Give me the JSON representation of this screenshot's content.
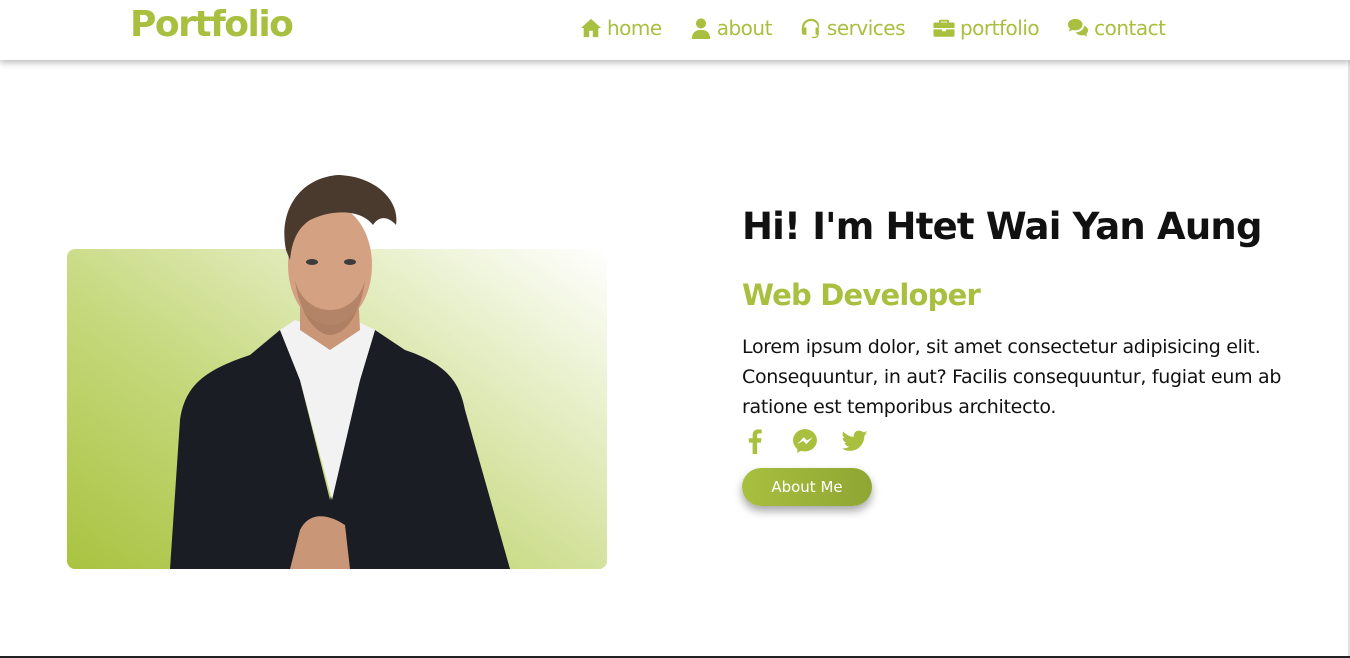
{
  "brand": {
    "name": "Portfolio",
    "color": "#a9bf3f"
  },
  "nav": {
    "items": [
      {
        "label": "home",
        "icon": "home-icon"
      },
      {
        "label": "about",
        "icon": "user-icon"
      },
      {
        "label": "services",
        "icon": "headset-icon"
      },
      {
        "label": "portfolio",
        "icon": "briefcase-icon"
      },
      {
        "label": "contact",
        "icon": "comments-icon"
      }
    ]
  },
  "hero": {
    "greeting": "Hi! I'm Htet Wai Yan Aung",
    "role": "Web Developer",
    "description": "Lorem ipsum dolor, sit amet consectetur adipisicing elit. Consequuntur, in aut? Facilis consequuntur, fugiat eum ab ratione est temporibus architecto.",
    "socials": [
      "facebook-icon",
      "messenger-icon",
      "twitter-icon"
    ],
    "button_label": "About Me"
  },
  "colors": {
    "accent": "#a9bf3f",
    "text": "#111111"
  }
}
